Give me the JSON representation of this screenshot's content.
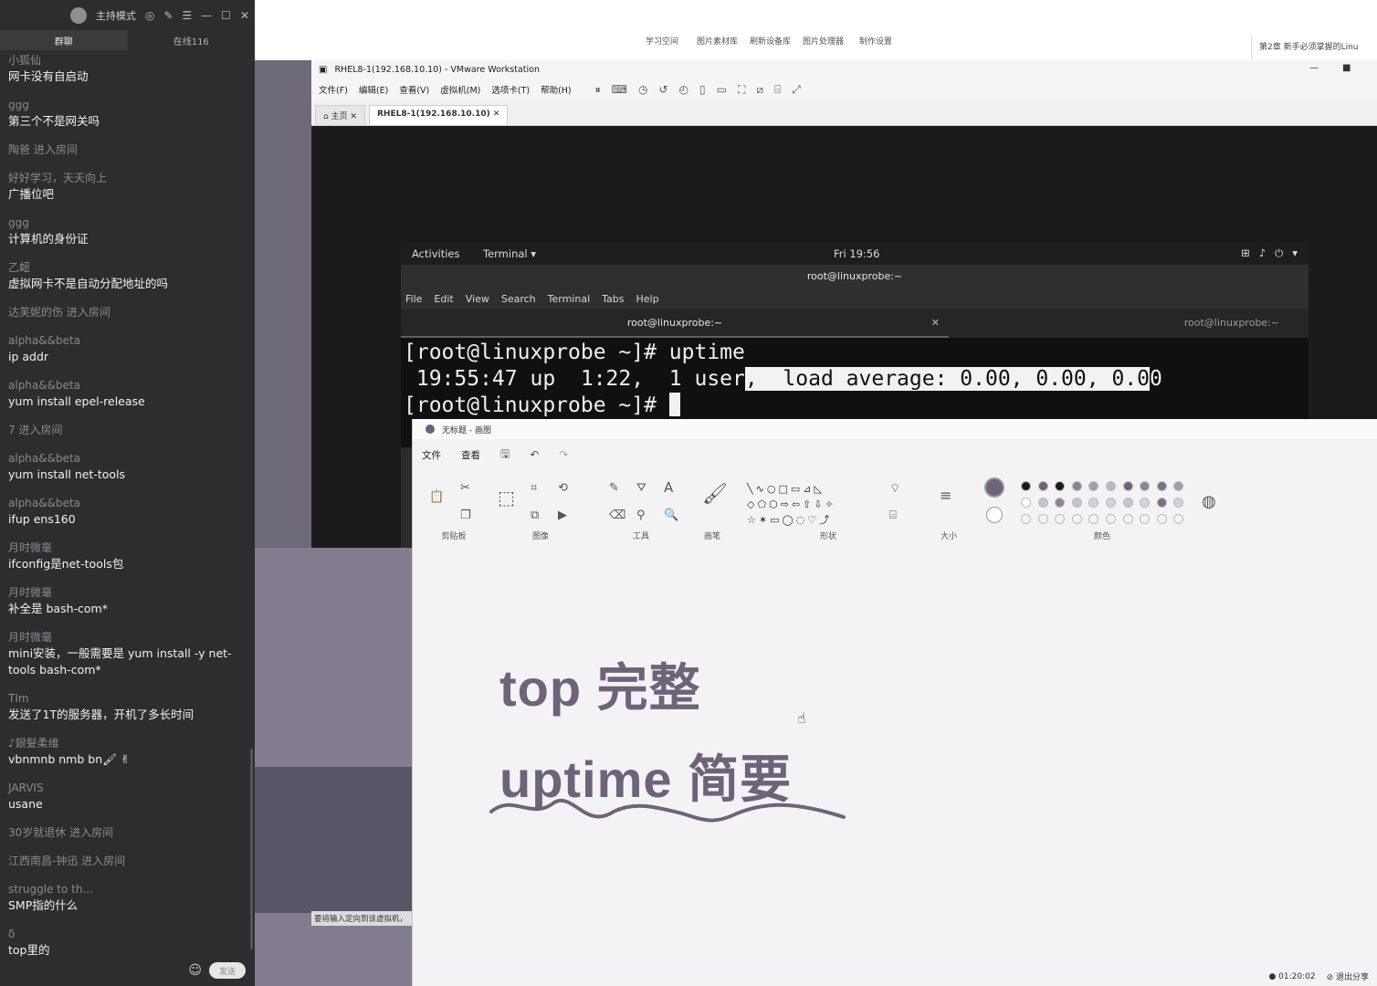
{
  "chat": {
    "header_title": "主持模式",
    "tabs": [
      {
        "label": "群聊"
      },
      {
        "label": "在线116"
      }
    ],
    "messages": [
      {
        "user": "小狐仙",
        "text": "网卡没有自启动"
      },
      {
        "user": "ggg",
        "text": "第三个不是网关吗"
      },
      {
        "user": "陶爸 进入房间",
        "text": ""
      },
      {
        "user": "好好学习，天天向上",
        "text": "广播位吧"
      },
      {
        "user": "ggg",
        "text": "计算机的身份证"
      },
      {
        "user": "乙衄",
        "text": "虚拟网卡不是自动分配地址的吗"
      },
      {
        "user": "达芙妮的伤 进入房间",
        "text": ""
      },
      {
        "user": "alpha&&beta",
        "text": "ip addr"
      },
      {
        "user": "alpha&&beta",
        "text": "yum install epel-release"
      },
      {
        "user": "7 进入房间",
        "text": ""
      },
      {
        "user": "alpha&&beta",
        "text": "yum install net-tools"
      },
      {
        "user": "alpha&&beta",
        "text": "ifup ens160"
      },
      {
        "user": "月时微毫",
        "text": "ifconfig是net-tools包"
      },
      {
        "user": "月时微毫",
        "text": "补全是 bash-com*"
      },
      {
        "user": "月时微毫",
        "text": "mini安装，一般需要是 yum install  -y net-tools bash-com*"
      },
      {
        "user": "TIm",
        "text": "发送了1T的服务器，开机了多长时间"
      },
      {
        "user": "♪銀髮柔维",
        "text": "vbnmnb nmb bn🖌 ✌"
      },
      {
        "user": "JARVIS",
        "text": "usane"
      },
      {
        "user": "30岁就退休 进入房间",
        "text": ""
      },
      {
        "user": "江西南昌-钟迅 进入房间",
        "text": ""
      },
      {
        "user": "struggle to th...",
        "text": "SMP指的什么"
      },
      {
        "user": "δ",
        "text": "top里的"
      }
    ],
    "send_label": "发送"
  },
  "desktop": {
    "tools": [
      "学习空间",
      "图片素材库",
      "刷新设备库",
      "图片处理器",
      "制作设置"
    ],
    "browser_tab": "第2章 新手必须掌握的Linu"
  },
  "vmware": {
    "title": "RHEL8-1(192.168.10.10) - VMware Workstation",
    "menu": [
      "文件(F)",
      "编辑(E)",
      "查看(V)",
      "虚拟机(M)",
      "选项卡(T)",
      "帮助(H)"
    ],
    "tabs": [
      {
        "label": "主页"
      },
      {
        "label": "RHEL8-1(192.168.10.10)"
      }
    ],
    "status_hint": "要将输入定向到该虚拟机，"
  },
  "gnome": {
    "activities": "Activities",
    "app": "Terminal ▾",
    "clock": "Fri 19:56"
  },
  "terminal": {
    "window_title": "root@linuxprobe:~",
    "menu": [
      "File",
      "Edit",
      "View",
      "Search",
      "Terminal",
      "Tabs",
      "Help"
    ],
    "tab1": "root@linuxprobe:~",
    "tab2": "root@linuxprobe:~",
    "line1": "[root@linuxprobe ~]# uptime",
    "line2_plain": " 19:55:47 up  1:22,  1 user",
    "line2_hl": ",  load average: 0.00, 0.00, 0.0",
    "line2_tail": "0",
    "line3": "[root@linuxprobe ~]# "
  },
  "paint": {
    "title": "无标题 - 画图",
    "menu": [
      "文件",
      "查看"
    ],
    "groups": {
      "clipboard": "剪贴板",
      "image": "图像",
      "tools": "工具",
      "brushes": "画笔",
      "shapes": "形状",
      "size": "大小",
      "colors": "颜色"
    },
    "note_line1": "top 完整",
    "note_line2": "uptime 简要",
    "status_time": "01:20:02",
    "status_exit": "退出分享"
  },
  "colors": {
    "chat_bg": "#2d2d2f",
    "terminal_bg": "#101010",
    "note_color": "#6e6378"
  }
}
